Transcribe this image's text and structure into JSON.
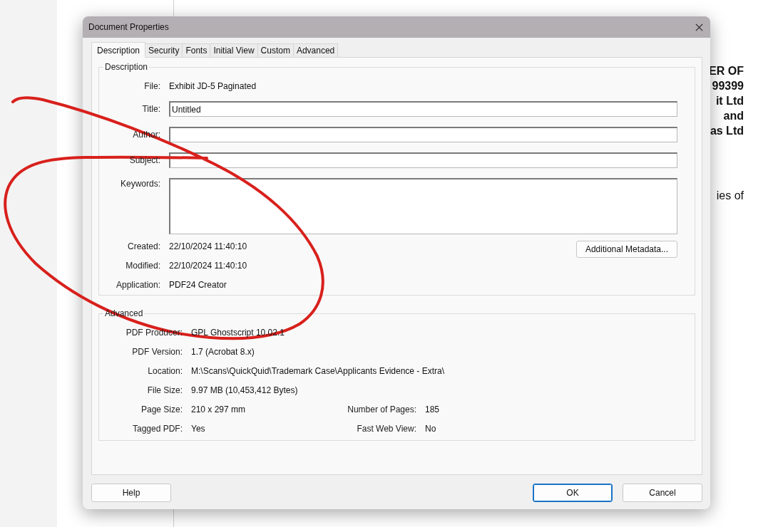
{
  "document": {
    "lines": [
      {
        "text": "ER OF",
        "bold": true
      },
      {
        "text": "99399",
        "bold": true
      },
      {
        "text": "it Ltd",
        "bold": true
      },
      {
        "text": "and",
        "bold": true
      },
      {
        "text": "as Ltd",
        "bold": true
      },
      {
        "text": "ies of",
        "bold": false
      }
    ]
  },
  "dialog": {
    "title": "Document Properties",
    "tabs": [
      {
        "label": "Description",
        "selected": true
      },
      {
        "label": "Security",
        "selected": false
      },
      {
        "label": "Fonts",
        "selected": false
      },
      {
        "label": "Initial View",
        "selected": false
      },
      {
        "label": "Custom",
        "selected": false
      },
      {
        "label": "Advanced",
        "selected": false
      }
    ],
    "description": {
      "legend": "Description",
      "file": {
        "label": "File:",
        "value": "Exhibit JD-5 Paginated"
      },
      "fields": [
        {
          "label": "Title:",
          "value": "Untitled",
          "kind": "line"
        },
        {
          "label": "Author:",
          "kind": "line"
        },
        {
          "label": "Subject:",
          "kind": "line"
        },
        {
          "label": "Keywords:",
          "kind": "area"
        }
      ],
      "info": [
        {
          "label": "Created:",
          "value": "22/10/2024 11:40:10"
        },
        {
          "label": "Modified:",
          "value": "22/10/2024 11:40:10"
        },
        {
          "label": "Application:",
          "value": "PDF24 Creator"
        }
      ],
      "metadata_button": "Additional Metadata..."
    },
    "advanced": {
      "legend": "Advanced",
      "rows": [
        [
          {
            "label": "PDF Producer:",
            "value": "GPL Ghostscript 10.02.1"
          }
        ],
        [
          {
            "label": "PDF Version:",
            "value": "1.7 (Acrobat 8.x)"
          }
        ],
        [
          {
            "label": "Location:",
            "value": "M:\\Scans\\QuickQuid\\Trademark Case\\Applicants Evidence - Extra\\"
          }
        ],
        [
          {
            "label": "File Size:",
            "value": "9.97 MB (10,453,412 Bytes)"
          }
        ],
        [
          {
            "label": "Page Size:",
            "value": "210 x 297 mm"
          },
          {
            "label": "Number of Pages:",
            "value": "185"
          }
        ],
        [
          {
            "label": "Tagged PDF:",
            "value": "Yes"
          },
          {
            "label": "Fast Web View:",
            "value": "No"
          }
        ]
      ]
    },
    "buttons": [
      {
        "label": "Help",
        "default": false
      },
      {
        "label": "OK",
        "default": true
      },
      {
        "label": "Cancel",
        "default": false
      }
    ]
  }
}
